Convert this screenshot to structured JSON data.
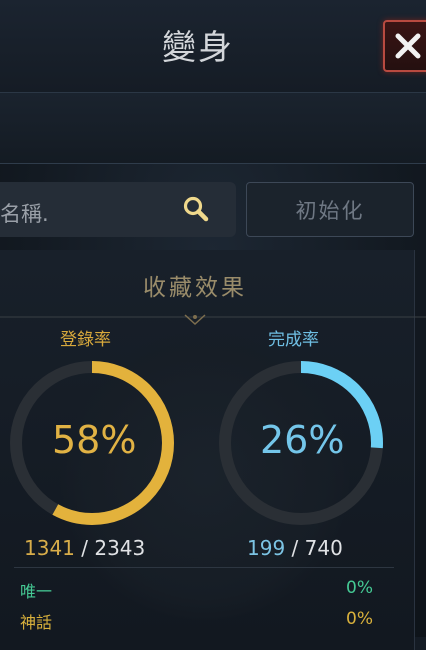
{
  "window": {
    "title": "變身",
    "close_icon": "close-icon"
  },
  "search": {
    "placeholder": "名稱.",
    "icon": "search-icon",
    "reset_label": "初始化"
  },
  "collection": {
    "title": "收藏效果",
    "registration": {
      "label": "登錄率",
      "percent_text": "58%",
      "percent": 58,
      "current": "1341",
      "total": "2343",
      "color": "#e3b23c"
    },
    "completion": {
      "label": "完成率",
      "percent_text": "26%",
      "percent": 26,
      "current": "199",
      "total": "740",
      "color": "#6cd0f5"
    },
    "separator": " / "
  },
  "grades": [
    {
      "name": "唯一",
      "value": "0%",
      "color": "#45c994"
    },
    {
      "name": "神話",
      "value": "0%",
      "color": "#d9b13c"
    }
  ]
}
